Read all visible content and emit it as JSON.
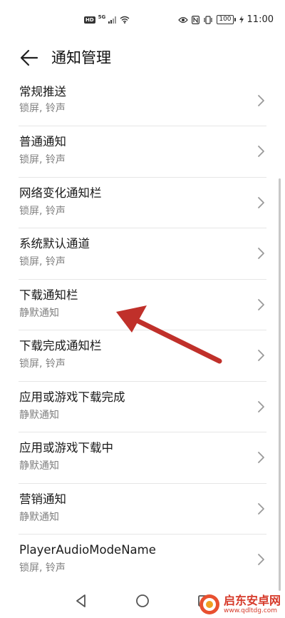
{
  "status_bar": {
    "hd_tag": "HD",
    "network_tag": "5G",
    "battery": "100",
    "time": "11:00"
  },
  "header": {
    "title": "通知管理"
  },
  "notification_channels": [
    {
      "title": "常规推送",
      "subtitle": "锁屏, 铃声"
    },
    {
      "title": "普通通知",
      "subtitle": "锁屏, 铃声"
    },
    {
      "title": "网络变化通知栏",
      "subtitle": "锁屏, 铃声"
    },
    {
      "title": "系统默认通道",
      "subtitle": "锁屏, 铃声"
    },
    {
      "title": "下载通知栏",
      "subtitle": "静默通知"
    },
    {
      "title": "下载完成通知栏",
      "subtitle": "锁屏, 铃声"
    },
    {
      "title": "应用或游戏下载完成",
      "subtitle": "静默通知"
    },
    {
      "title": "应用或游戏下载中",
      "subtitle": "静默通知"
    },
    {
      "title": "营销通知",
      "subtitle": "静默通知"
    },
    {
      "title": "PlayerAudioModeName",
      "subtitle": "锁屏, 铃声"
    }
  ],
  "watermark": {
    "name": "启东安卓网",
    "url": "www.qdltdg.com"
  },
  "colors": {
    "annotation_arrow": "#c0302a",
    "watermark": "#d63a2a",
    "divider": "#e6e6e6",
    "subtitle": "#808080"
  }
}
